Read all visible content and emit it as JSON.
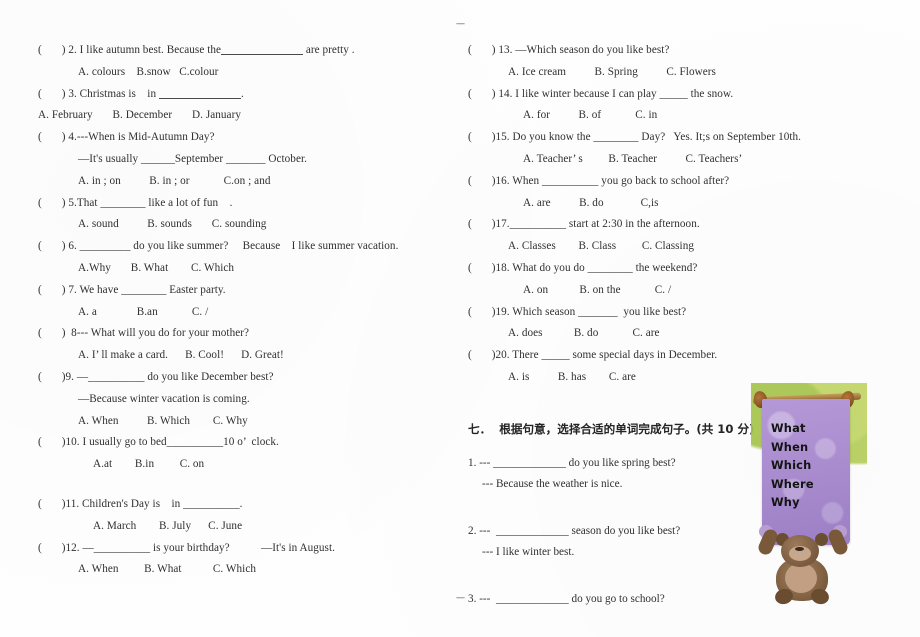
{
  "marks": {
    "top": "----",
    "bottom": "----"
  },
  "left_column": [
    {
      "lines": [
        "(       ) 2. I like autumn best. Because the",
        "A. colours    B.snow   C.colour"
      ],
      "q_tail": " are pretty .",
      "blank": "b-xl"
    },
    {
      "lines": [
        "(       ) 3. Christmas is    in ",
        "A. February       B. December       D. January"
      ],
      "q_tail": ".",
      "blank": "b-xl"
    },
    {
      "lines": [
        "(       ) 4.---When is Mid-Autumn Day?",
        "—It's usually ______September _______ October.",
        "A. in ; on          B. in ; or            C.on ; and"
      ]
    },
    {
      "lines": [
        "(       ) 5.That ________ like a lot of fun    .",
        "A. sound          B. sounds       C. sounding"
      ]
    },
    {
      "lines": [
        "(       ) 6. _________ do you like summer?     Because    I like summer vacation.",
        "A.Why       B. What        C. Which"
      ]
    },
    {
      "lines": [
        "(       ) 7. We have ________ Easter party.",
        "A. a              B.an            C. /"
      ]
    },
    {
      "lines": [
        "(       )  8--- What will you do for your mother?",
        "A. I’ ll make a card.      B. Cool!      D. Great!"
      ]
    },
    {
      "lines": [
        "(       )9. —__________ do you like December best?",
        "—Because winter vacation is coming.",
        "A. When          B. Which        C. Why"
      ]
    },
    {
      "lines": [
        "(       )10. I usually go to bed__________10 o’  clock.",
        "A.at        B.in         C. on"
      ]
    },
    {
      "lines": [
        "(       )11. Children's Day is    in __________.",
        "A. March        B. July      C. June"
      ]
    },
    {
      "lines": [
        "(       )12. —__________ is your birthday?           —It's in August.",
        "A. When         B. What           C. Which"
      ]
    }
  ],
  "right_column": [
    {
      "lines": [
        "(       ) 13. —Which season do you like best?",
        "A. Ice cream          B. Spring          C. Flowers"
      ]
    },
    {
      "lines": [
        "(       ) 14. I like winter because I can play _____ the snow.",
        "A. for          B. of            C. in"
      ]
    },
    {
      "lines": [
        "(       )15. Do you know the ________ Day?   Yes. It;s on September 10th.",
        "A. Teacher’ s         B. Teacher          C. Teachers’"
      ]
    },
    {
      "lines": [
        "(       )16. When __________ you go back to school after?",
        "A. are          B. do             C,is"
      ]
    },
    {
      "lines": [
        "(       )17.__________ start at 2:30 in the afternoon.",
        "A. Classes        B. Class         C. Classing"
      ]
    },
    {
      "lines": [
        "(       )18. What do you do ________ the weekend?",
        "A. on           B. on the            C. /"
      ]
    },
    {
      "lines": [
        "(       )19. Which season _______  you like best?",
        "A. does           B. do            C. are"
      ]
    },
    {
      "lines": [
        "(       )20. There _____ some special days in December.",
        "A. is          B. has        C. are"
      ]
    }
  ],
  "section_seven": {
    "heading": "七．  根据句意，选择合适的单词完成句子。(共 10 分)",
    "items": [
      {
        "question": "1. --- _____________ do you like spring best?",
        "answer": "--- Because the weather is nice."
      },
      {
        "question": "2. ---  _____________ season do you like best?",
        "answer": "--- I like winter best."
      },
      {
        "question": "3. ---  _____________ do you go to school?",
        "answer": ""
      }
    ]
  },
  "illustration": {
    "banner_words": [
      "What",
      "When",
      "Which",
      "Where",
      "Why"
    ],
    "banner_color": "#b69ad9",
    "foliage_color": "#b6cf5c",
    "bear_color": "#6b4d31"
  }
}
